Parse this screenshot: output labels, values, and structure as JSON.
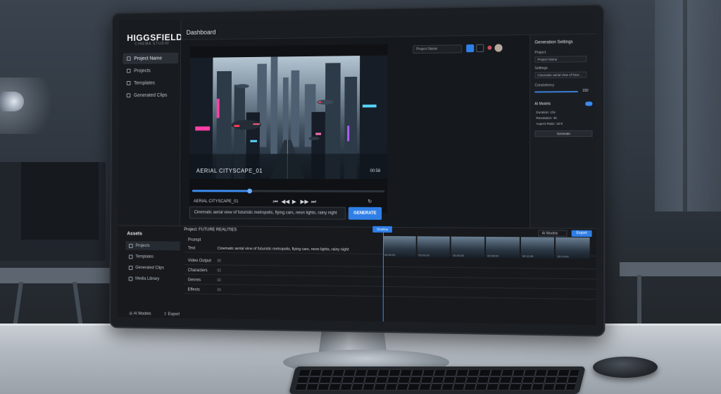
{
  "brand": {
    "name": "HIGGSFIELD",
    "subtitle": "CINEMA STUDIO"
  },
  "topbar": {
    "title": "Dashboard",
    "project_select": "Project Name"
  },
  "sidebar": {
    "items": [
      {
        "label": "Project Name",
        "icon": "folder-icon",
        "active": true
      },
      {
        "label": "Projects",
        "icon": "grid-icon",
        "active": false
      },
      {
        "label": "Templates",
        "icon": "template-icon",
        "active": false
      },
      {
        "label": "Generated Clips",
        "icon": "film-icon",
        "active": false
      }
    ]
  },
  "preview": {
    "clip_title": "AERIAL CITYSCAPE_01",
    "duration": "00:58",
    "clip_name": "AERIAL CITYSCAPE_01",
    "progress": 0.3,
    "prompt": "Cinematic aerial view of futuristic metropolis, flying cars, neon lights, rainy night",
    "generate_label": "GENERATE"
  },
  "right_panel": {
    "title": "Generation Settings",
    "project_label": "Project",
    "project_value": "Project Name",
    "settings_label": "Settings",
    "settings_value": "Cinematic aerial view of futur...",
    "consistency_label": "Consistency",
    "consistency_value": "150",
    "ai_models_label": "AI Models",
    "kv": [
      {
        "k": "Duration:",
        "v": "10s"
      },
      {
        "k": "Resolution:",
        "v": "4K"
      },
      {
        "k": "Aspect Ratio:",
        "v": "16:9"
      }
    ],
    "generate_label": "Generate"
  },
  "timeline": {
    "assets_title": "Assets",
    "assets": [
      {
        "label": "Projects",
        "active": true
      },
      {
        "label": "Templates",
        "active": false
      },
      {
        "label": "Generated Clips",
        "active": false
      },
      {
        "label": "Media Library",
        "active": false
      }
    ],
    "project_header": "Project: FUTURE REALITIES",
    "playhead_label": "Timeline",
    "ai_models_dropdown": "AI Models",
    "export_label": "Export",
    "prompt_track": "Prompt",
    "text_label": "Text",
    "text_value": "Cinematic aerial view of futuristic metropolis, flying cars, neon lights, rainy night",
    "tracks": [
      {
        "label": "Video Output",
        "num": "00"
      },
      {
        "label": "Characters",
        "num": "02"
      },
      {
        "label": "Genres",
        "num": "02"
      },
      {
        "label": "Effects",
        "num": "03"
      }
    ],
    "thumb_times": [
      "00:00:00",
      "00:03:00",
      "00:05:45",
      "00:08:00",
      "00:10:45",
      "00:14:00"
    ],
    "footer_ai_models": "AI Models",
    "footer_export": "Export"
  },
  "colors": {
    "accent": "#2f7fe6",
    "panel": "#1a1d22",
    "neon_pink": "#ff3fa4",
    "neon_cyan": "#56d6ff"
  }
}
